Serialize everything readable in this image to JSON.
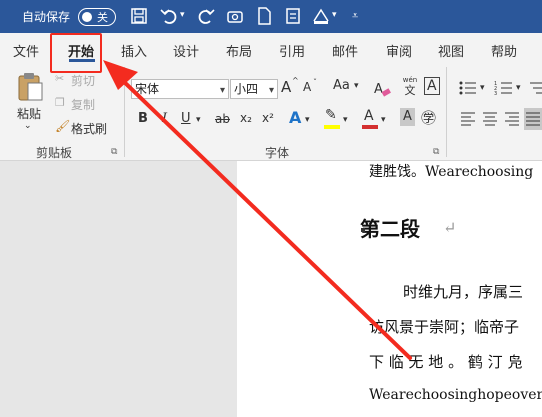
{
  "titlebar": {
    "autosave_label": "自动保存",
    "autosave_state": "关"
  },
  "tabs": [
    {
      "label": "文件"
    },
    {
      "label": "开始"
    },
    {
      "label": "插入"
    },
    {
      "label": "设计"
    },
    {
      "label": "布局"
    },
    {
      "label": "引用"
    },
    {
      "label": "邮件"
    },
    {
      "label": "审阅"
    },
    {
      "label": "视图"
    },
    {
      "label": "帮助"
    }
  ],
  "ribbon": {
    "clipboard": {
      "paste_label": "粘贴",
      "cut_label": "剪切",
      "copy_label": "复制",
      "format_painter_label": "格式刷",
      "group_label": "剪贴板"
    },
    "font": {
      "font_name": "宋体",
      "font_size": "小四",
      "group_label": "字体",
      "bold": "B",
      "italic": "I",
      "underline": "U",
      "strike": "ab",
      "subscript": "x₂",
      "superscript": "x²",
      "text_effect": "A",
      "highlight": "A",
      "font_color": "A",
      "char_shading": "A",
      "grow": "A",
      "shrink": "A",
      "change_case": "Aa",
      "phonetic_top": "wén",
      "phonetic_bottom": "文"
    }
  },
  "document": {
    "line1": "建胜饯。Wearechoosing",
    "heading": "第二段",
    "line2": "时维九月，序属三",
    "line3": "访风景于崇阿；临帝子",
    "line4": "下 临 无 地 。 鹤 汀 凫",
    "line5": "Wearechoosinghopeover"
  },
  "colors": {
    "titlebar": "#2b579a",
    "annotation_red": "#f32b1f",
    "highlight_yellow": "#ffff00",
    "font_red": "#d32f2f"
  }
}
